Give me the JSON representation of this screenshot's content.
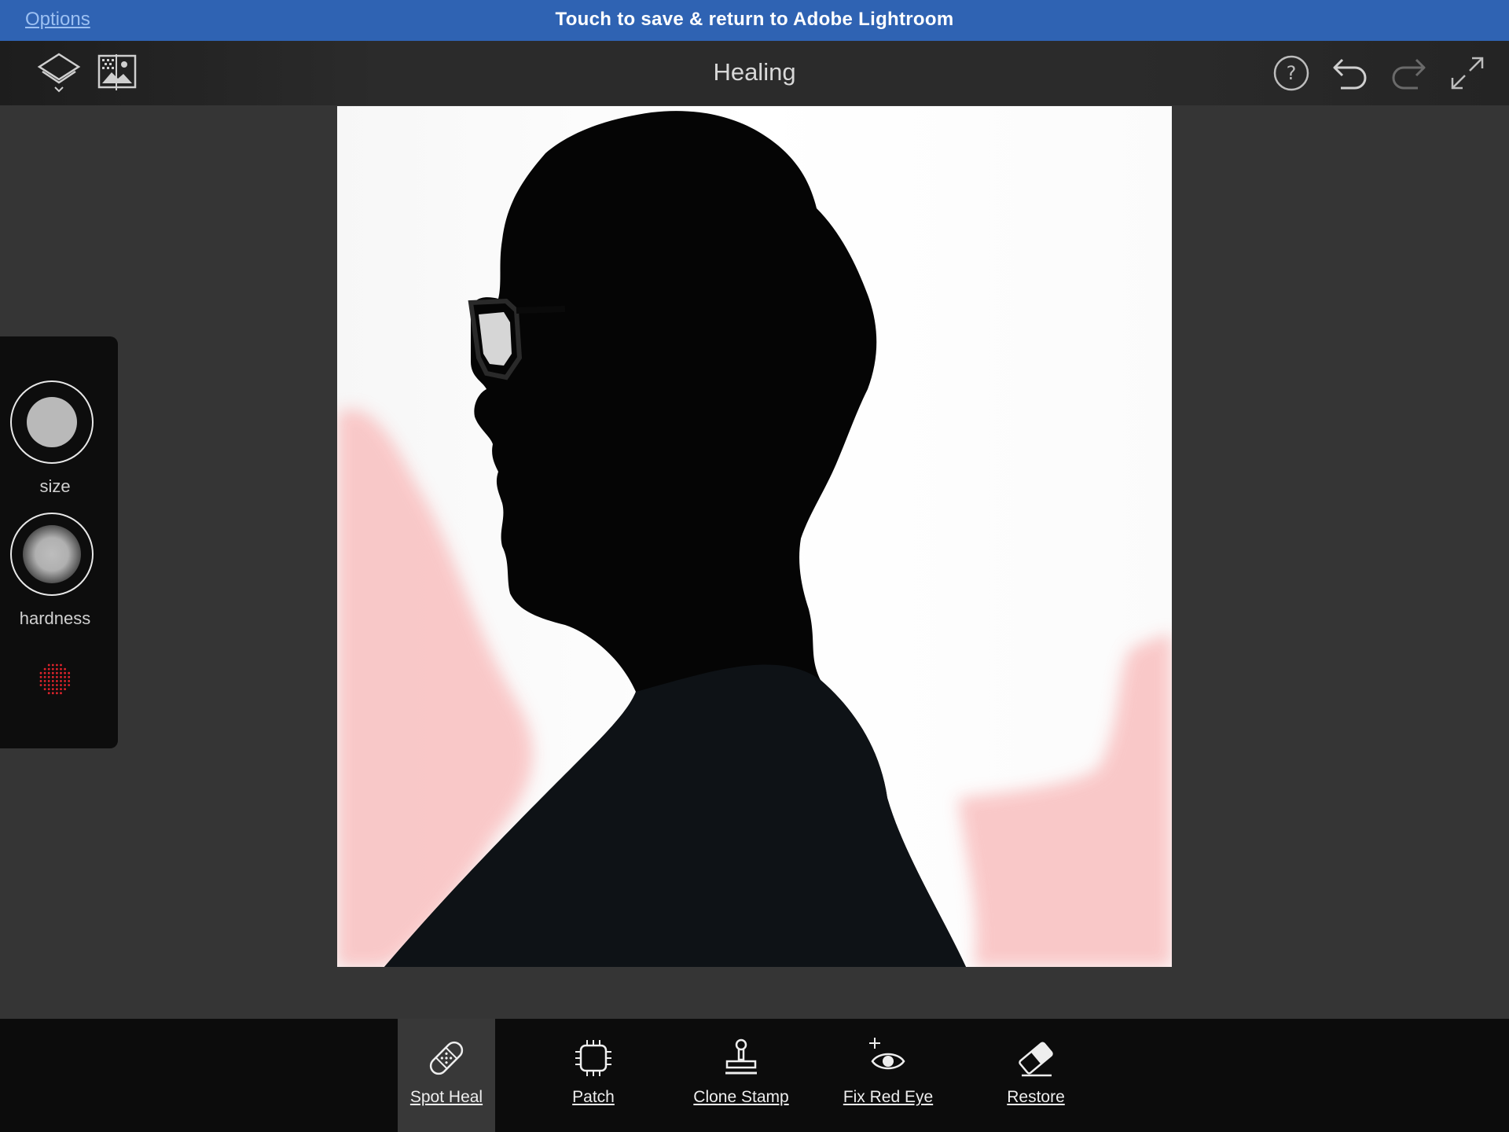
{
  "topbar": {
    "options_label": "Options",
    "banner_text": "Touch to save & return to Adobe Lightroom"
  },
  "header": {
    "title": "Healing",
    "left_icons": [
      "layers-icon",
      "image-compare-icon"
    ],
    "right_icons": [
      "help-icon",
      "undo-icon",
      "redo-icon",
      "fullscreen-icon"
    ]
  },
  "brush_panel": {
    "size_label": "size",
    "hardness_label": "hardness",
    "overlay_icon": "dot-grid-icon",
    "overlay_color": "#e0242c"
  },
  "canvas": {
    "description_color_overlay": "#f9c9c9"
  },
  "tools": [
    {
      "label": "Spot Heal",
      "icon": "bandage-icon",
      "active": true
    },
    {
      "label": "Patch",
      "icon": "patch-icon",
      "active": false
    },
    {
      "label": "Clone Stamp",
      "icon": "stamp-icon",
      "active": false
    },
    {
      "label": "Fix Red Eye",
      "icon": "red-eye-icon",
      "active": false
    },
    {
      "label": "Restore",
      "icon": "eraser-icon",
      "active": false
    }
  ],
  "colors": {
    "topbar": "#2f63b3",
    "workspace": "#353535",
    "toolbar": "#0c0c0c",
    "active_tool": "#383838"
  }
}
